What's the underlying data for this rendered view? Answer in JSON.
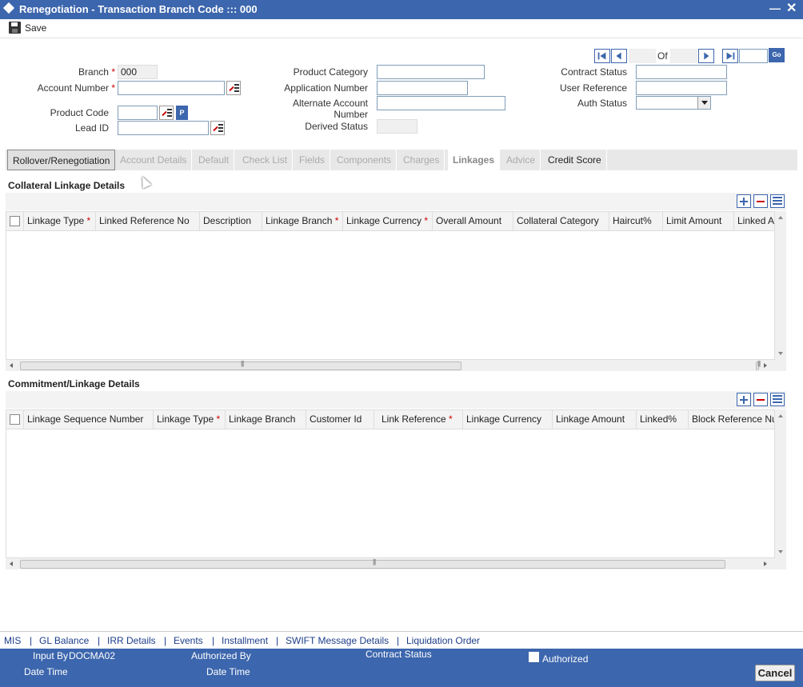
{
  "window": {
    "title": "Renegotiation - Transaction Branch Code ::: 000",
    "minimize": "—",
    "close": "✕"
  },
  "toolbar": {
    "save_label": "Save"
  },
  "header": {
    "branch_label": "Branch",
    "branch_value": "000",
    "account_number_label": "Account Number",
    "account_number_value": "",
    "product_code_label": "Product Code",
    "product_code_value": "",
    "product_code_p": "P",
    "lead_id_label": "Lead ID",
    "lead_id_value": "",
    "product_category_label": "Product Category",
    "product_category_value": "",
    "application_number_label": "Application Number",
    "application_number_value": "",
    "alternate_account_label_1": "Alternate Account",
    "alternate_account_label_2": "Number",
    "alternate_account_value": "",
    "derived_status_label": "Derived Status",
    "derived_status_value": "",
    "contract_status_label": "Contract Status",
    "contract_status_value": "",
    "user_reference_label": "User Reference",
    "user_reference_value": "",
    "auth_status_label": "Auth Status",
    "auth_status_value": ""
  },
  "pager": {
    "of_label": "Of",
    "current": "",
    "total": "",
    "go_label": "Go"
  },
  "tabs": [
    {
      "label": "Rollover/Renegotiation"
    },
    {
      "label": "Account Details"
    },
    {
      "label": "Default"
    },
    {
      "label": "Check List"
    },
    {
      "label": "Fields"
    },
    {
      "label": "Components"
    },
    {
      "label": "Charges"
    },
    {
      "label": "Linkages"
    },
    {
      "label": "Advice"
    },
    {
      "label": "Credit Score"
    }
  ],
  "collateral": {
    "title": "Collateral Linkage Details",
    "columns": [
      {
        "label": "Linkage Type",
        "required": true
      },
      {
        "label": "Linked Reference No",
        "required": false
      },
      {
        "label": "Description",
        "required": false
      },
      {
        "label": "Linkage Branch",
        "required": true
      },
      {
        "label": "Linkage Currency",
        "required": true
      },
      {
        "label": "Overall Amount",
        "required": false
      },
      {
        "label": "Collateral Category",
        "required": false
      },
      {
        "label": "Haircut%",
        "required": false
      },
      {
        "label": "Limit Amount",
        "required": false
      },
      {
        "label": "Linked A",
        "required": false
      }
    ]
  },
  "commitment": {
    "title": "Commitment/Linkage Details",
    "columns": [
      {
        "label": "Linkage Sequence Number",
        "required": false
      },
      {
        "label": "Linkage Type",
        "required": true
      },
      {
        "label": "Linkage Branch",
        "required": false
      },
      {
        "label": "Customer Id",
        "required": false
      },
      {
        "label": "Link Reference",
        "required": true
      },
      {
        "label": "Linkage Currency",
        "required": false
      },
      {
        "label": "Linkage Amount",
        "required": false
      },
      {
        "label": "Linked%",
        "required": false
      },
      {
        "label": "Block Reference Nu",
        "required": false
      }
    ]
  },
  "links": [
    {
      "label": "MIS"
    },
    {
      "label": "GL Balance"
    },
    {
      "label": "IRR Details"
    },
    {
      "label": "Events"
    },
    {
      "label": "Installment"
    },
    {
      "label": "SWIFT Message Details"
    },
    {
      "label": "Liquidation Order"
    }
  ],
  "link_separator": "|",
  "footer": {
    "input_by_label": "Input By",
    "input_by_value": "DOCMA02",
    "date_time_label": "Date Time",
    "authorized_by_label": "Authorized By",
    "auth_date_time_label": "Date Time",
    "contract_status_label": "Contract Status",
    "authorized_label": "Authorized",
    "cancel_label": "Cancel"
  },
  "colors": {
    "brand": "#3c66ad",
    "required": "#cc0000",
    "link": "#1d3e8a"
  }
}
